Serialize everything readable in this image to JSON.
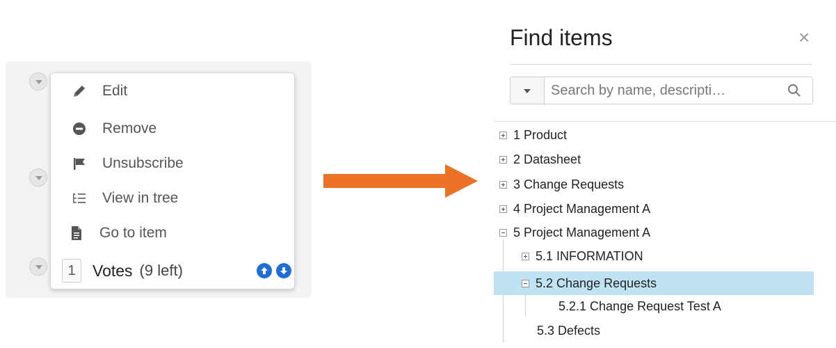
{
  "context_menu": {
    "items": [
      {
        "label": "Edit",
        "icon": "pencil-icon"
      },
      {
        "label": "Remove",
        "icon": "minus-circle-icon"
      },
      {
        "label": "Unsubscribe",
        "icon": "flag-icon"
      },
      {
        "label": "View in tree",
        "icon": "tree-list-icon"
      },
      {
        "label": "Go to item",
        "icon": "document-icon"
      }
    ],
    "votes": {
      "count": "1",
      "label": "Votes",
      "remaining": "(9 left)"
    }
  },
  "find_items": {
    "title": "Find items",
    "close": "×",
    "search_placeholder": "Search by name, descripti…",
    "tree": [
      {
        "label": "1 Product",
        "state": "collapsed"
      },
      {
        "label": "2 Datasheet",
        "state": "collapsed"
      },
      {
        "label": "3 Change Requests",
        "state": "collapsed"
      },
      {
        "label": "4 Project Management A",
        "state": "collapsed"
      },
      {
        "label": "5 Project Management A",
        "state": "expanded"
      },
      {
        "label": "5.1 INFORMATION",
        "state": "collapsed"
      },
      {
        "label": "5.2 Change Requests",
        "state": "expanded",
        "selected": true
      },
      {
        "label": "5.2.1 Change Request Test A",
        "state": "leaf"
      },
      {
        "label": "5.3 Defects",
        "state": "leaf"
      }
    ]
  },
  "colors": {
    "arrow": "#ec7124",
    "vote_button": "#1f6fd6",
    "selection": "#bfe3f2"
  }
}
